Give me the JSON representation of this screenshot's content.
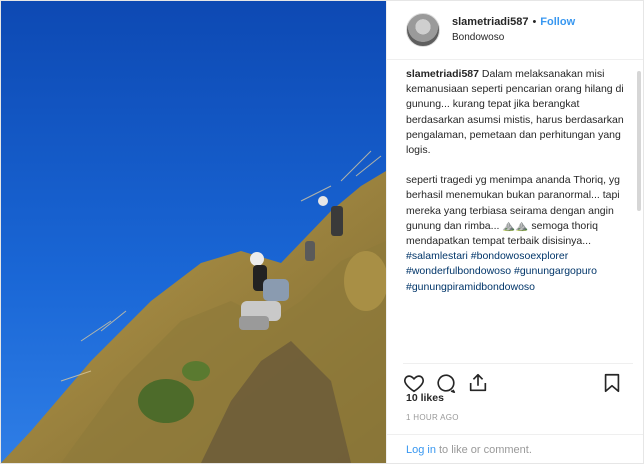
{
  "header": {
    "username": "slametriadi587",
    "separator": "•",
    "follow_label": "Follow",
    "location": "Bondowoso"
  },
  "caption": {
    "username": "slametriadi587",
    "paragraph1": "Dalam melaksanakan misi kemanusiaan seperti pencarian orang hilang di gunung... kurang tepat jika berangkat berdasarkan asumsi mistis, harus berdasarkan pengalaman, pemetaan dan perhitungan yang logis.",
    "paragraph2": "seperti tragedi yg menimpa ananda Thoriq, yg berhasil menemukan bukan paranormal... tapi mereka yang terbiasa seirama dengan angin gunung dan rimba...",
    "emoji": "⛰️⛰️",
    "paragraph2_end": "semoga thoriq mendapatkan tempat terbaik disisinya...",
    "hashtags": [
      "#salamlestari #bondowosoexplorer",
      "#wonderfulbondowoso #gunungargopuro",
      "#gunungpiramidbondowoso"
    ]
  },
  "stats": {
    "likes": "10 likes",
    "time": "1 HOUR AGO"
  },
  "footer": {
    "login_link": "Log in",
    "login_text": "to like or comment."
  },
  "icons": [
    "heart-icon",
    "comment-icon",
    "share-icon",
    "bookmark-icon"
  ],
  "colors": {
    "link": "#3897f0",
    "hashtag": "#003569",
    "sky": "#1a5fc8"
  }
}
